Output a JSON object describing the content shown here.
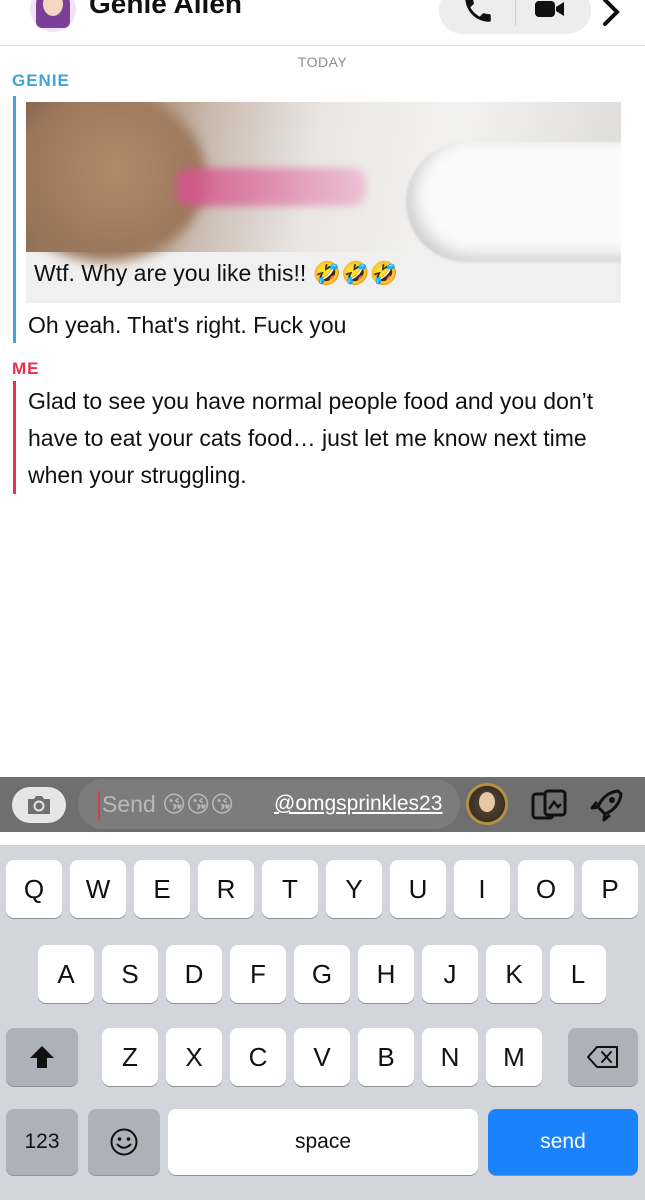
{
  "header": {
    "contact_name": "Genie Allen",
    "icons": [
      "avatar",
      "phone-icon",
      "video-camera-icon",
      "chevron-right-icon"
    ]
  },
  "chat": {
    "date_label": "TODAY",
    "genie": {
      "sender_label": "GENIE",
      "snap_caption": "Wtf. Why are you like this!! 🤣🤣🤣",
      "message": "Oh yeah. That's right. Fuck you"
    },
    "me": {
      "sender_label": "ME",
      "message": "Glad to see you have normal people food and you don’t have to eat your cats food… just let me know next time when your struggling."
    }
  },
  "composer": {
    "placeholder": "Send",
    "typed_emojis": "😘😘😘",
    "mention": "@omgsprinkles23",
    "icons": [
      "camera-icon",
      "bitmoji-icon",
      "memories-icon",
      "rocket-icon"
    ]
  },
  "keyboard": {
    "row1": [
      "Q",
      "W",
      "E",
      "R",
      "T",
      "Y",
      "U",
      "I",
      "O",
      "P"
    ],
    "row2": [
      "A",
      "S",
      "D",
      "F",
      "G",
      "H",
      "J",
      "K",
      "L"
    ],
    "row3": [
      "Z",
      "X",
      "C",
      "V",
      "B",
      "N",
      "M"
    ],
    "numbers_label": "123",
    "space_label": "space",
    "send_label": "send"
  },
  "colors": {
    "genie_accent": "#3ea4d9",
    "me_accent": "#ee2e50",
    "send_key": "#1a82fb"
  }
}
